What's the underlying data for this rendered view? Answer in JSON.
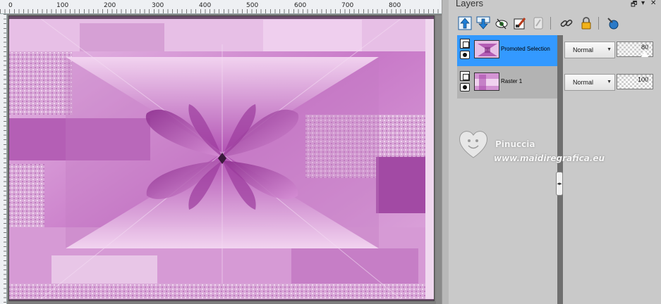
{
  "ruler": {
    "ticks": [
      "0",
      "100",
      "200",
      "300",
      "400",
      "500",
      "600",
      "700",
      "800"
    ]
  },
  "panel": {
    "title": "Layers",
    "restore_icon": "restore-window-icon",
    "menu_icon": "panel-menu-icon",
    "close_icon": "pin-icon"
  },
  "toolbar": [
    {
      "name": "new-raster-layer-icon"
    },
    {
      "name": "new-vector-layer-icon"
    },
    {
      "name": "visibility-toggle-icon"
    },
    {
      "name": "new-adjustment-layer-icon"
    },
    {
      "name": "mask-icon"
    },
    {
      "name": "link-icon"
    },
    {
      "name": "lock-icon"
    },
    {
      "name": "delete-layer-icon"
    }
  ],
  "layers": [
    {
      "name": "Promoted Selection",
      "blend_mode": "Normal",
      "opacity": "80",
      "selected": true
    },
    {
      "name": "Raster 1",
      "blend_mode": "Normal",
      "opacity": "100",
      "selected": false
    }
  ],
  "watermark": {
    "name": "Pinuccia",
    "url": "www.maidiregrafica.eu"
  },
  "colors": {
    "selection": "#3399ff",
    "panel_bg": "#c9c9c9",
    "canvas_main": "#c060c0",
    "canvas_light": "#f0c8ee"
  }
}
